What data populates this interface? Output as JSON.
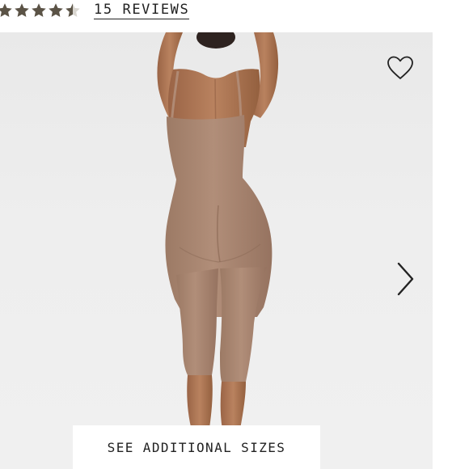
{
  "rating": {
    "stars_value": 4.5,
    "stars_max": 5,
    "star_color": "#5b5346",
    "star_empty_color": "#d9d6d0",
    "reviews_label": "15 REVIEWS"
  },
  "product_image": {
    "background_color": "#ececec",
    "garment_color": "#a9846f",
    "skin_color": "#b07a5a"
  },
  "controls": {
    "wishlist_icon": "heart-outline-icon",
    "next_icon": "chevron-right-icon",
    "sizes_button_label": "SEE ADDITIONAL SIZES"
  }
}
